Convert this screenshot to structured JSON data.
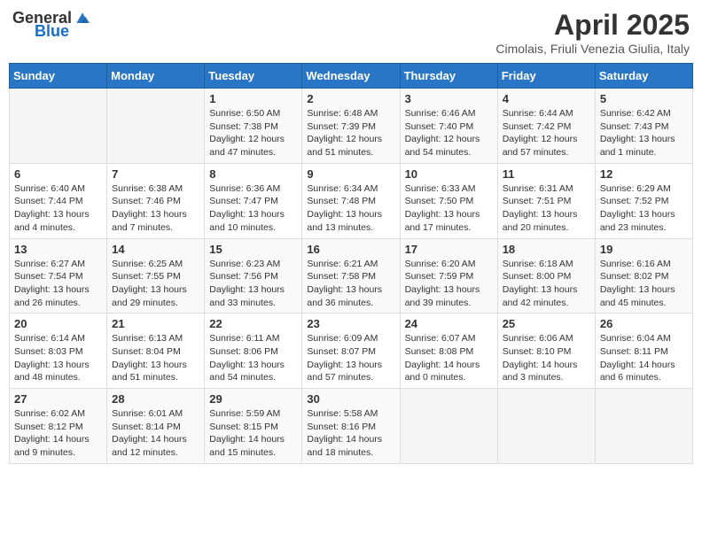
{
  "header": {
    "logo_general": "General",
    "logo_blue": "Blue",
    "month_title": "April 2025",
    "subtitle": "Cimolais, Friuli Venezia Giulia, Italy"
  },
  "weekdays": [
    "Sunday",
    "Monday",
    "Tuesday",
    "Wednesday",
    "Thursday",
    "Friday",
    "Saturday"
  ],
  "weeks": [
    [
      {
        "day": "",
        "info": ""
      },
      {
        "day": "",
        "info": ""
      },
      {
        "day": "1",
        "info": "Sunrise: 6:50 AM\nSunset: 7:38 PM\nDaylight: 12 hours and 47 minutes."
      },
      {
        "day": "2",
        "info": "Sunrise: 6:48 AM\nSunset: 7:39 PM\nDaylight: 12 hours and 51 minutes."
      },
      {
        "day": "3",
        "info": "Sunrise: 6:46 AM\nSunset: 7:40 PM\nDaylight: 12 hours and 54 minutes."
      },
      {
        "day": "4",
        "info": "Sunrise: 6:44 AM\nSunset: 7:42 PM\nDaylight: 12 hours and 57 minutes."
      },
      {
        "day": "5",
        "info": "Sunrise: 6:42 AM\nSunset: 7:43 PM\nDaylight: 13 hours and 1 minute."
      }
    ],
    [
      {
        "day": "6",
        "info": "Sunrise: 6:40 AM\nSunset: 7:44 PM\nDaylight: 13 hours and 4 minutes."
      },
      {
        "day": "7",
        "info": "Sunrise: 6:38 AM\nSunset: 7:46 PM\nDaylight: 13 hours and 7 minutes."
      },
      {
        "day": "8",
        "info": "Sunrise: 6:36 AM\nSunset: 7:47 PM\nDaylight: 13 hours and 10 minutes."
      },
      {
        "day": "9",
        "info": "Sunrise: 6:34 AM\nSunset: 7:48 PM\nDaylight: 13 hours and 13 minutes."
      },
      {
        "day": "10",
        "info": "Sunrise: 6:33 AM\nSunset: 7:50 PM\nDaylight: 13 hours and 17 minutes."
      },
      {
        "day": "11",
        "info": "Sunrise: 6:31 AM\nSunset: 7:51 PM\nDaylight: 13 hours and 20 minutes."
      },
      {
        "day": "12",
        "info": "Sunrise: 6:29 AM\nSunset: 7:52 PM\nDaylight: 13 hours and 23 minutes."
      }
    ],
    [
      {
        "day": "13",
        "info": "Sunrise: 6:27 AM\nSunset: 7:54 PM\nDaylight: 13 hours and 26 minutes."
      },
      {
        "day": "14",
        "info": "Sunrise: 6:25 AM\nSunset: 7:55 PM\nDaylight: 13 hours and 29 minutes."
      },
      {
        "day": "15",
        "info": "Sunrise: 6:23 AM\nSunset: 7:56 PM\nDaylight: 13 hours and 33 minutes."
      },
      {
        "day": "16",
        "info": "Sunrise: 6:21 AM\nSunset: 7:58 PM\nDaylight: 13 hours and 36 minutes."
      },
      {
        "day": "17",
        "info": "Sunrise: 6:20 AM\nSunset: 7:59 PM\nDaylight: 13 hours and 39 minutes."
      },
      {
        "day": "18",
        "info": "Sunrise: 6:18 AM\nSunset: 8:00 PM\nDaylight: 13 hours and 42 minutes."
      },
      {
        "day": "19",
        "info": "Sunrise: 6:16 AM\nSunset: 8:02 PM\nDaylight: 13 hours and 45 minutes."
      }
    ],
    [
      {
        "day": "20",
        "info": "Sunrise: 6:14 AM\nSunset: 8:03 PM\nDaylight: 13 hours and 48 minutes."
      },
      {
        "day": "21",
        "info": "Sunrise: 6:13 AM\nSunset: 8:04 PM\nDaylight: 13 hours and 51 minutes."
      },
      {
        "day": "22",
        "info": "Sunrise: 6:11 AM\nSunset: 8:06 PM\nDaylight: 13 hours and 54 minutes."
      },
      {
        "day": "23",
        "info": "Sunrise: 6:09 AM\nSunset: 8:07 PM\nDaylight: 13 hours and 57 minutes."
      },
      {
        "day": "24",
        "info": "Sunrise: 6:07 AM\nSunset: 8:08 PM\nDaylight: 14 hours and 0 minutes."
      },
      {
        "day": "25",
        "info": "Sunrise: 6:06 AM\nSunset: 8:10 PM\nDaylight: 14 hours and 3 minutes."
      },
      {
        "day": "26",
        "info": "Sunrise: 6:04 AM\nSunset: 8:11 PM\nDaylight: 14 hours and 6 minutes."
      }
    ],
    [
      {
        "day": "27",
        "info": "Sunrise: 6:02 AM\nSunset: 8:12 PM\nDaylight: 14 hours and 9 minutes."
      },
      {
        "day": "28",
        "info": "Sunrise: 6:01 AM\nSunset: 8:14 PM\nDaylight: 14 hours and 12 minutes."
      },
      {
        "day": "29",
        "info": "Sunrise: 5:59 AM\nSunset: 8:15 PM\nDaylight: 14 hours and 15 minutes."
      },
      {
        "day": "30",
        "info": "Sunrise: 5:58 AM\nSunset: 8:16 PM\nDaylight: 14 hours and 18 minutes."
      },
      {
        "day": "",
        "info": ""
      },
      {
        "day": "",
        "info": ""
      },
      {
        "day": "",
        "info": ""
      }
    ]
  ]
}
